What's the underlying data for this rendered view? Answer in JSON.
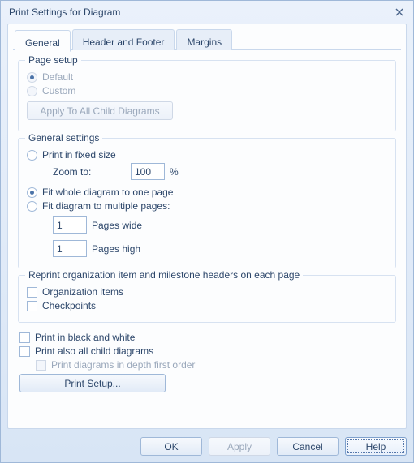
{
  "window": {
    "title": "Print Settings for Diagram"
  },
  "tabs": {
    "general": "General",
    "header_footer": "Header and Footer",
    "margins": "Margins"
  },
  "page_setup": {
    "legend": "Page setup",
    "default": "Default",
    "custom": "Custom",
    "apply_children": "Apply To All Child Diagrams"
  },
  "general_settings": {
    "legend": "General settings",
    "fixed": "Print in fixed size",
    "zoom_to": "Zoom to:",
    "zoom_value": "100",
    "zoom_pct": "%",
    "fit_one": "Fit whole diagram to one page",
    "fit_multi": "Fit diagram to multiple pages:",
    "pages_wide_value": "1",
    "pages_wide": "Pages wide",
    "pages_high_value": "1",
    "pages_high": "Pages high"
  },
  "reprint": {
    "legend": "Reprint organization item and milestone headers on each page",
    "org_items": "Organization items",
    "checkpoints": "Checkpoints"
  },
  "misc": {
    "bw": "Print in black and white",
    "all_children": "Print also all child diagrams",
    "depth_first": "Print diagrams in depth first order",
    "print_setup": "Print Setup..."
  },
  "buttons": {
    "ok": "OK",
    "apply": "Apply",
    "cancel": "Cancel",
    "help": "Help"
  }
}
